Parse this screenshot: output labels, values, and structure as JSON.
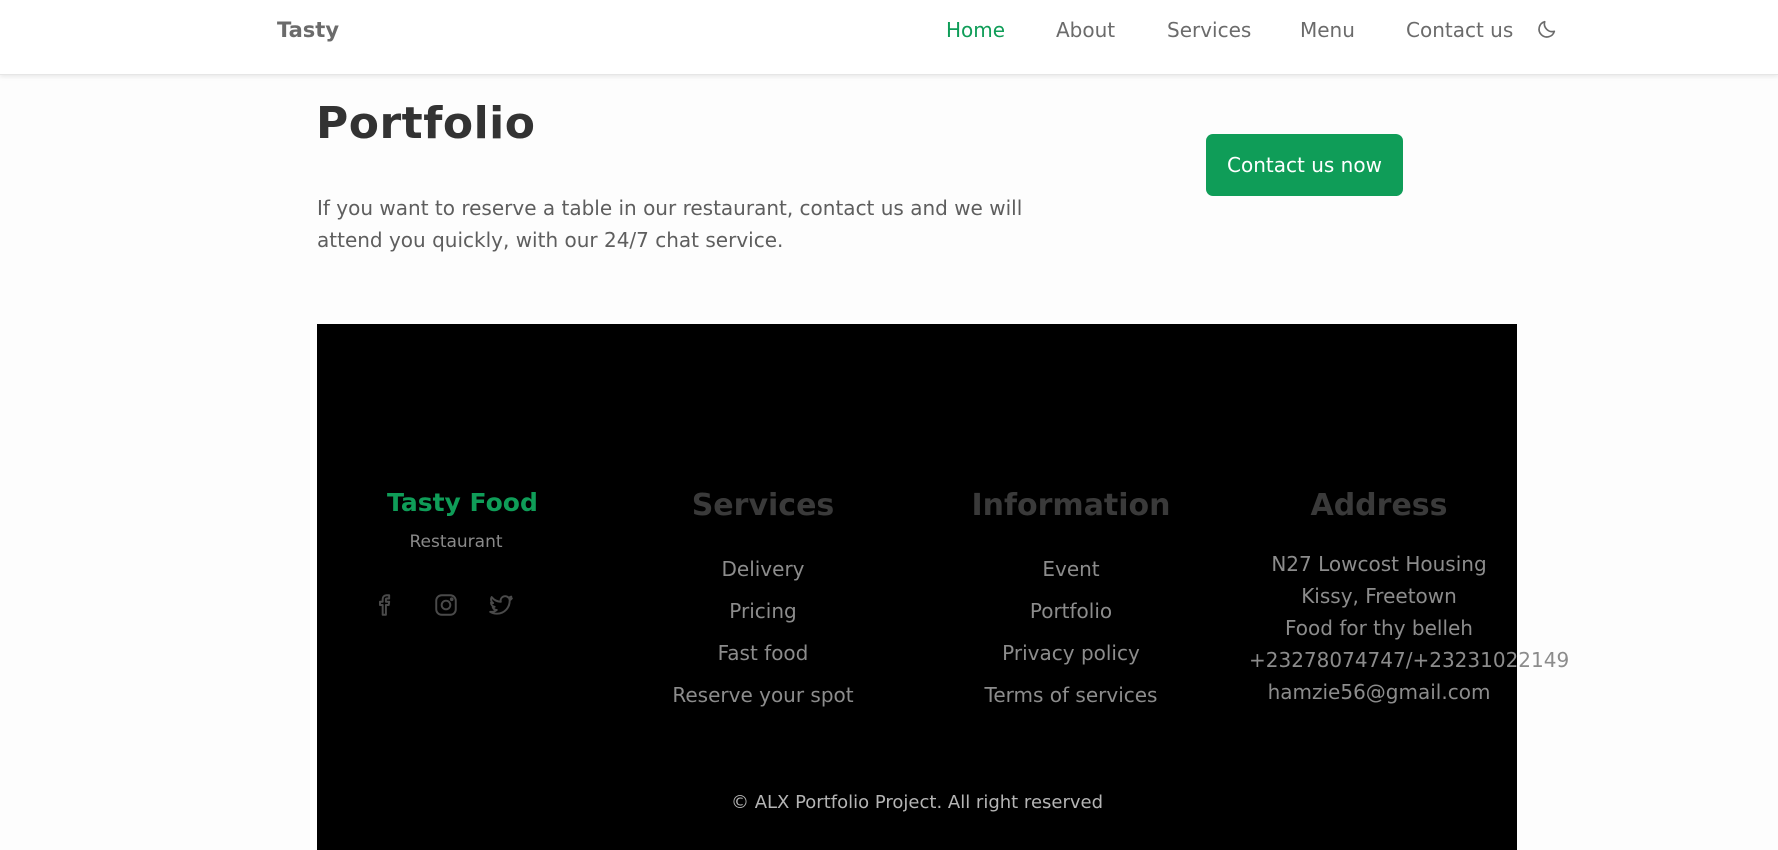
{
  "header": {
    "brand": "Tasty",
    "nav": [
      {
        "label": "Home",
        "active": true
      },
      {
        "label": "About"
      },
      {
        "label": "Services"
      },
      {
        "label": "Menu"
      },
      {
        "label": "Contact us"
      }
    ],
    "theme_icon": "moon-icon"
  },
  "hero": {
    "title": "Portfolio",
    "description": "If you want to reserve a table in our restaurant, contact us and we will attend you quickly, with our 24/7 chat service.",
    "cta_label": "Contact us now"
  },
  "footer": {
    "brand": {
      "title": "Tasty Food",
      "subtitle": "Restaurant",
      "social_icons": [
        "facebook-icon",
        "instagram-icon",
        "twitter-icon"
      ]
    },
    "services": {
      "heading": "Services",
      "links": [
        "Delivery",
        "Pricing",
        "Fast food",
        "Reserve your spot"
      ]
    },
    "information": {
      "heading": "Information",
      "links": [
        "Event",
        "Portfolio",
        "Privacy policy",
        "Terms of services"
      ]
    },
    "address": {
      "heading": "Address",
      "lines": [
        "N27 Lowcost Housing Kissy, Freetown",
        "Food for thy belleh",
        "+23278074747/+23231022149",
        "hamzie56@gmail.com"
      ]
    },
    "copyright": "© ALX Portfolio Project. All right reserved"
  },
  "colors": {
    "accent": "#0f9d58",
    "footer_bg": "#000000",
    "text_muted": "#8c8c8c"
  }
}
